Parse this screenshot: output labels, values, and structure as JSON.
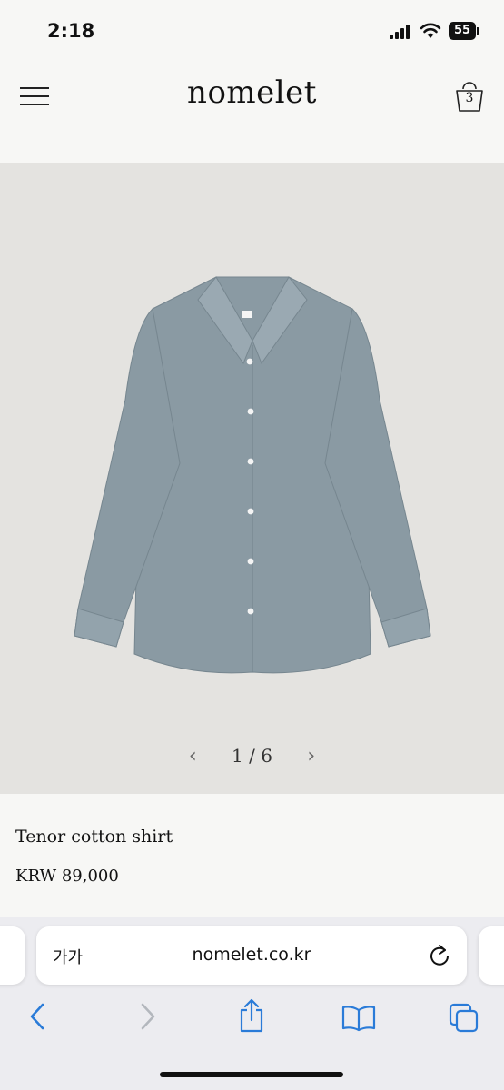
{
  "status_bar": {
    "time": "2:18",
    "battery": "55"
  },
  "header": {
    "brand": "nomelet",
    "cart_count": "3"
  },
  "gallery": {
    "current": "1",
    "separator": "/",
    "total": "6",
    "pager_text": "1 / 6"
  },
  "product": {
    "name": "Tenor cotton shirt",
    "price": "KRW 89,000",
    "shirt_color": "#8a9aa3"
  },
  "browser": {
    "text_size_label": "가가",
    "url": "nomelet.co.kr"
  },
  "icons": [
    "menu-icon",
    "cart-icon",
    "chevron-left-icon",
    "chevron-right-icon",
    "reload-icon",
    "back-icon",
    "forward-icon",
    "share-icon",
    "bookmarks-icon",
    "tabs-icon"
  ]
}
